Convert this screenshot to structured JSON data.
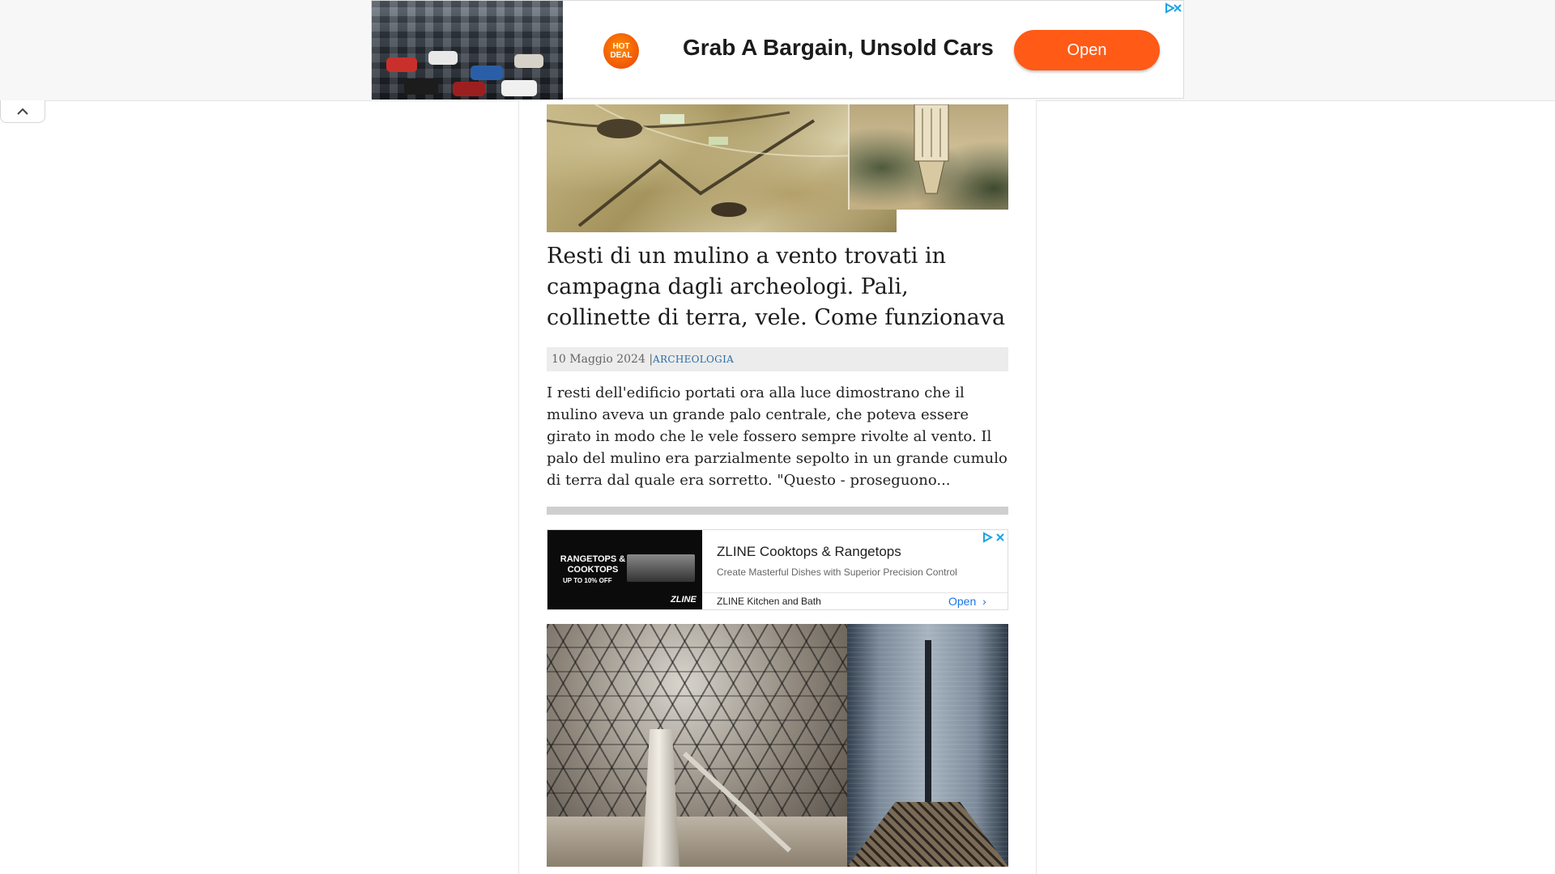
{
  "top_ad": {
    "badge_text": "HOT DEAL",
    "headline": "Grab A Bargain, Unsold Cars",
    "cta": "Open",
    "adchoices_icon": "adchoices-icon",
    "close_icon": "close-icon",
    "accent_color": "#ff5a16"
  },
  "collapse_tab": {
    "icon": "chevron-up-icon"
  },
  "article": {
    "title": "Resti di un mulino a vento trovati in campagna dagli archeologi. Pali, collinette di terra, vele. Come funzionava",
    "date": "10 Maggio 2024",
    "separator": "|",
    "category": "ARCHEOLOGIA",
    "excerpt": "I resti dell'edificio portati ora alla luce dimostrano che il mulino aveva un grande palo centrale, che poteva essere girato in modo che le vele fossero sempre rivolte al vento. Il palo del mulino era parzialmente sepolto in un grande cumulo di terra dal quale era sorretto. \"Questo - proseguono..."
  },
  "inline_ad": {
    "image_text_1": "RANGETOPS & COOKTOPS",
    "image_text_2": "UP TO 10% OFF",
    "image_brand": "ZLINE",
    "title": "ZLINE Cooktops & Rangetops",
    "subtitle": "Create Masterful Dishes with Superior Precision Control",
    "advertiser": "ZLINE Kitchen and Bath",
    "cta": "Open",
    "cta_arrow": "›"
  }
}
